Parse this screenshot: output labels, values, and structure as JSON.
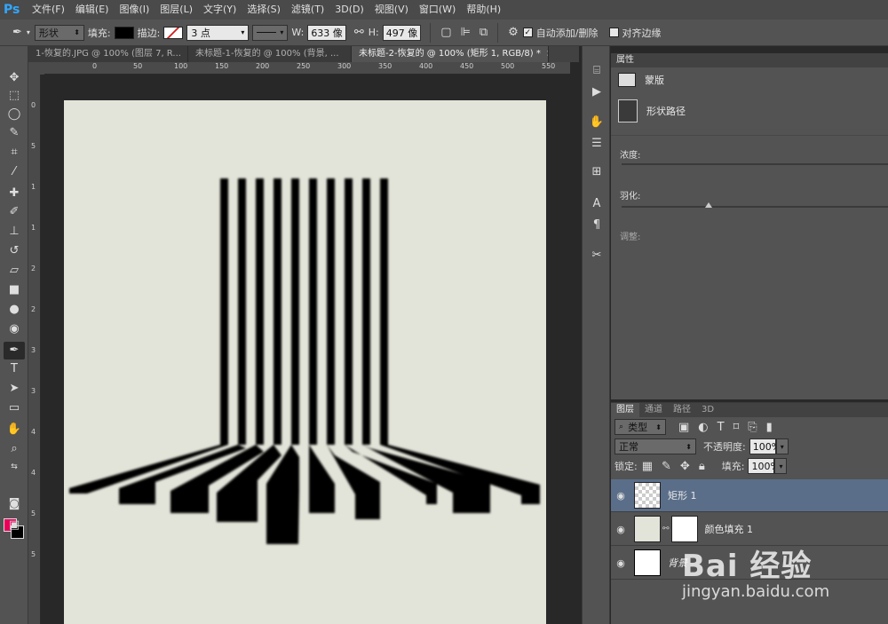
{
  "app": {
    "logo": "Ps"
  },
  "menu": [
    "文件(F)",
    "编辑(E)",
    "图像(I)",
    "图层(L)",
    "文字(Y)",
    "选择(S)",
    "滤镜(T)",
    "3D(D)",
    "视图(V)",
    "窗口(W)",
    "帮助(H)"
  ],
  "options": {
    "mode": "形状",
    "fill_label": "填充:",
    "stroke_label": "描边:",
    "stroke_width": "3 点",
    "w_label": "W:",
    "w_value": "633 像",
    "h_label": "H:",
    "h_value": "497 像",
    "auto_add_delete": "自动添加/删除",
    "align_edges": "对齐边缘",
    "fill_color": "#000000"
  },
  "tabs": [
    {
      "label": "1-恢复的.JPG @ 100% (图层 7, R...",
      "close": "×"
    },
    {
      "label": "未标题-1-恢复的 @ 100% (背景, ...",
      "close": "×"
    },
    {
      "label": "未标题-2-恢复的 @ 100% (矩形 1, RGB/8) *",
      "close": "×"
    }
  ],
  "ruler_h": [
    "0",
    "50",
    "100",
    "150",
    "200",
    "250",
    "300",
    "350",
    "400",
    "450",
    "500",
    "550"
  ],
  "ruler_v": [
    "0",
    "5",
    "1",
    "1",
    "2",
    "2",
    "3",
    "3",
    "4",
    "4",
    "5",
    "5"
  ],
  "properties": {
    "header": "属性",
    "mask_label": "蒙版",
    "shape_path_label": "形状路径",
    "density_label": "浓度:",
    "feather_label": "羽化:",
    "adjust_label": "调整:"
  },
  "layers_panel": {
    "tabs": [
      "图层",
      "通道",
      "路径",
      "3D"
    ],
    "kind_filter": "类型",
    "blend_mode": "正常",
    "opacity_label": "不透明度:",
    "opacity_value": "100%",
    "lock_label": "锁定:",
    "fill_label": "填充:",
    "fill_value": "100%",
    "layers": [
      {
        "name": "矩形 1",
        "selected": true
      },
      {
        "name": "颜色填充 1",
        "selected": false
      },
      {
        "name": "背景",
        "selected": false
      }
    ]
  },
  "colors": {
    "foreground": "#e8005a",
    "background": "#000000",
    "document_bg": "#e3e4d9"
  },
  "watermark": {
    "brand": "Bai 经验",
    "url": "jingyan.baidu.com"
  }
}
